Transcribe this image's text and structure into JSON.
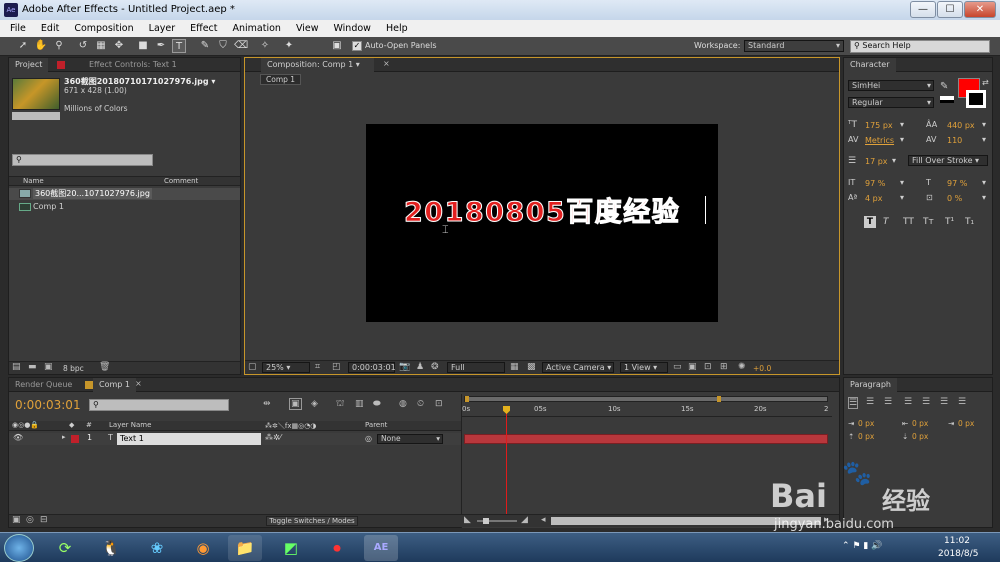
{
  "window": {
    "title": "Adobe After Effects - Untitled Project.aep *",
    "app_badge": "Ae",
    "min": "—",
    "max": "☐",
    "close": "✕"
  },
  "menu": [
    "File",
    "Edit",
    "Composition",
    "Layer",
    "Effect",
    "Animation",
    "View",
    "Window",
    "Help"
  ],
  "toolbar": {
    "auto_open": "Auto-Open Panels",
    "workspace_label": "Workspace:",
    "workspace_value": "Standard",
    "search_placeholder": "Search Help"
  },
  "project": {
    "tab_project": "Project",
    "tab_effects": "Effect Controls: Text 1",
    "asset_name": "360截图20180710171027976.jpg ▾",
    "asset_dims": "671 x 428 (1.00)",
    "asset_colors": "Millions of Colors",
    "col_name": "Name",
    "col_comment": "Comment",
    "items": [
      {
        "label": "360截图20...1071027976.jpg"
      },
      {
        "label": "Comp 1"
      }
    ],
    "bpc": "8 bpc"
  },
  "composition": {
    "tab": "Composition: Comp 1",
    "crumb": "Comp 1",
    "text": "20180805百度经验",
    "zoom": "25%",
    "timecode": "0:00:03:01",
    "resolution": "Full",
    "camera": "Active Camera",
    "views": "1 View",
    "exposure": "+0.0"
  },
  "character": {
    "tab": "Character",
    "font": "SimHei",
    "style": "Regular",
    "fill_color": "#ff0000",
    "size": "175 px",
    "leading": "440 px",
    "kerning": "Metrics",
    "tracking": "110",
    "stroke_width": "17 px",
    "stroke_mode": "Fill Over Stroke",
    "vscale": "97 %",
    "hscale": "97 %",
    "baseline": "4 px",
    "tsume": "0 %",
    "styles": [
      "T",
      "T",
      "TT",
      "Tт",
      "T¹",
      "T₁"
    ]
  },
  "paragraph": {
    "tab": "Paragraph",
    "indent": [
      "0 px",
      "0 px",
      "0 px",
      "0 px",
      "0 px"
    ]
  },
  "timeline": {
    "tab_render": "Render Queue",
    "tab_comp": "Comp 1",
    "timecode": "0:00:03:01",
    "col_layer": "Layer Name",
    "col_parent": "Parent",
    "col_num": "#",
    "layers": [
      {
        "num": "1",
        "name": "Text 1",
        "parent": "None"
      }
    ],
    "ruler": [
      "0s",
      "05s",
      "10s",
      "15s",
      "20s",
      "2"
    ],
    "toggle": "Toggle Switches / Modes"
  },
  "taskbar": {
    "time": "11:02",
    "date": "2018/8/5",
    "ae_label": "AE"
  },
  "watermark": {
    "brand": "Bai",
    "brand2": "经验",
    "url": "jingyan.baidu.com"
  }
}
